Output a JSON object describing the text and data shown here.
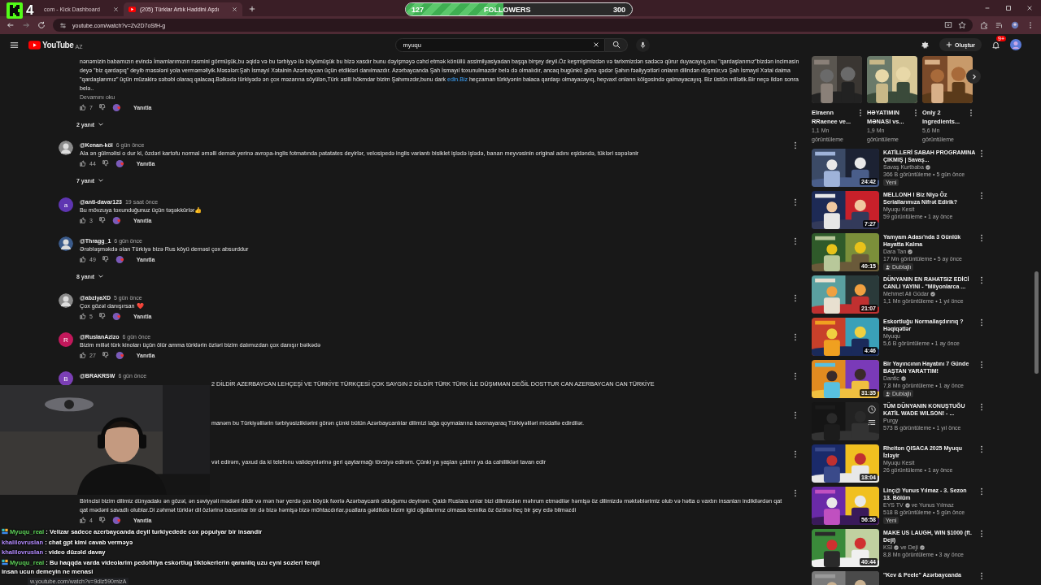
{
  "browser": {
    "tabs": [
      {
        "title": "com - Kick Dashboard",
        "selected": false
      },
      {
        "title": "(205) Türklar Artık Haddini Aşdı",
        "selected": true
      }
    ],
    "url": "youtube.com/watch?v=Zv2D7oSfH-g"
  },
  "overlay": {
    "kick_count": "4",
    "followers": {
      "current": "127",
      "label": "FOLLOWERS",
      "goal": "300",
      "level": 0.43
    }
  },
  "youtube": {
    "logo": "YouTube",
    "region": "AZ",
    "search": "myuqu",
    "create": "Oluştur",
    "notifications": "9+"
  },
  "top_comment": {
    "body_parts": [
      {
        "text": "nənəmizin babamızın evində İmamlarımızın rəsmini görmüşük,bu əqidə və bu tərbiyyə ilə böyümüşük bu bizə xasdır bunu dəyişməyə cəhd etmək könüllü assimilyasiyadan başqa birşey deyil.Öz keşmişimizdən və tarixmizdən sadəcə qürur duyacayıq,onu \"qardaşlarımız\"bizdən incimasin deyə \"biz qardaşıq\" deyib məsələni yola verməməliyik.Məsələn:Şah İsmayıl Xətainin Azərbaycan üçün etdikləri danılmazdır. Azərbaycanda Şah İsmayıl toxunulmazdır belə də olmalıdır, ancaq bugünkü günə qədər Şahın fəaliyyətləri onların dilindən düşmür,və Şah İsmayıl Xətai daima \"qardaşlarımız\" üçün müzakirə səbəbi olaraq qalacaq.Bəlkədə türkiyədə ən çox məzarına söyülən,Türk əsilli hökmdar bizim Şahımızdır,bunu dark ",
        "link": false
      },
      {
        "text": "edin.Biz",
        "link": true
      },
      {
        "text": " heçzaman türkiyənin balaca qardaşı olmayacayıq, heçvaxt onların kölgəsində qalmayacayıq. Biz üstün millətik.Bir neçə ildən sonra belə..",
        "link": false
      }
    ],
    "read_more": "Devamını oku",
    "likes": "7",
    "reply": "Yanıtla",
    "replies": "2 yanıt"
  },
  "comments": [
    {
      "author": "@Kenan-köl",
      "time": "6 gün önce",
      "text": "Ala ən gülməlisi o dur ki, özdəri kartofu normal əməlli demək yerinə avropa-inglis fotmatında patatates deyirlər, velosipedə inglis variantı bisiklet işlədə işlədə, banan meyvəsinin original adını eşidəndə, tükləri səpələnir",
      "covered": false,
      "likes": "44",
      "reply": "Yanıtla",
      "replies": "7 yanıt"
    },
    {
      "author": "@anti-davar123",
      "time": "19 saat önce",
      "avatar": {
        "kind": "letter",
        "letter": "a",
        "color": "#5e35b1"
      },
      "text": "Bu mövzuya toxunduğunuz üçün təşəkkürlər👍",
      "covered": false,
      "likes": "3",
      "reply": "Yanıtla"
    },
    {
      "author": "@Thragg_1",
      "time": "6 gün önce",
      "text": "Ərəbləşməkdə olan Türkiyə bizə Rus köyü deməsi çox absurddur",
      "covered": false,
      "likes": "49",
      "reply": "Yanıtla",
      "replies": "8 yanıt"
    },
    {
      "author": "@abziyaXD",
      "time": "5 gün önce",
      "text": "Çox gözəl danışırsan ❤️",
      "covered": false,
      "likes": "5",
      "reply": "Yanıtla"
    },
    {
      "author": "@RuslanAzizo",
      "time": "6 gün önce",
      "avatar": {
        "kind": "letter",
        "letter": "R",
        "color": "#c2185b"
      },
      "text": "Bizim millət türk kinoları üçün ölür amma türklərin özləri bizim dalımızdan çox danışır bəlkədə",
      "covered": false,
      "likes": "27",
      "reply": "Yanıtla"
    },
    {
      "author": "@BRAKRSW",
      "time": "6 gün önce",
      "avatar": {
        "kind": "letter",
        "letter": "B",
        "color": "#7b3fb5"
      },
      "text": "2 DİLDİR AZERBAYCAN LEHÇEŞİ VE TÜRKİYE TÜRKÇESİ ÇOK SAYGIN 2 DİLDİR TÜRK TÜRK İLE DÜŞMMAN DEĞİL DOSTTUR CAN AZERBAYCAN CAN TÜRKİYE",
      "covered": true
    },
    {
      "text": "manəm bu Türkiyəlilərin tərbiyəsizliklərini görən çünki bütün Azərbaycanlılar dilimizi lağa qoymalarına baxmayaraq Türkiyəliləri müdafiə edirdilər.",
      "covered": true
    },
    {
      "text": "vət edirəm, yaxud da ki telefonu valideynlərinə geri qaytarmağı tövsiyə edirəm. Çünki ya yaşları çatmır ya da cahillikləri tavan edir",
      "covered": true
    },
    {
      "text": "Birincisi bizim dilimiz dünyadakı ən gözəl, ən səviyyəli mədəni dildir və mən hər yerdə çox böyük fəxrlə Azərbaycanlı olduğumu deyirəm. Qaldı Ruslara onlar bizi dilimizdən məhrum etmədilər həmişə öz dilimizdə məktəblərimiz olub və hətta o vaxtın insanları indikilərdən qat qat mədəni savadlı olublar.Di zəhmət türklər dil özlərinə baxsınlar bir də bizə həmişə bizə möhtacdırlar.puallara gəldikdə bizim igid oğullarımız olmasa texnika öz özünə heç bir şey edə bilməzdi",
      "covered": false,
      "likes": "4",
      "reply": "Yanıtla"
    }
  ],
  "sidebar": {
    "shorts": [
      {
        "title": "Elraenn RRaenee ve...",
        "views": "1,1 Mn görüntüleme"
      },
      {
        "title": "HƏYATIMIN MƏNASI vs...",
        "views": "1,9 Mn görüntüleme"
      },
      {
        "title": "Only 2 Ingredients...",
        "views": "5,6 Mn görüntüleme"
      }
    ],
    "videos": [
      {
        "title": "KATİLLERİ SABAH PROGRAMINA ÇIKMIŞ | Savaş...",
        "channels": [
          {
            "name": "Savaş Kurtbaba",
            "verified": true
          }
        ],
        "meta": "366 B görüntüleme • 5 gün önce",
        "badge": {
          "kind": "new",
          "text": "Yeni"
        },
        "duration": "24:42",
        "hovered": false
      },
      {
        "title": "MELLONH I Biz Niyə Öz Seriallarımıza Nifrət Edirik?",
        "channels": [
          {
            "name": "Myuqu Kesit",
            "verified": false
          }
        ],
        "meta": "59 görüntüleme • 1 ay önce",
        "duration": "7:27",
        "hovered": false
      },
      {
        "title": "Yamyam Adası'nda 3 Günlük Hayatta Kalma",
        "channels": [
          {
            "name": "Dara Tan",
            "verified": true
          }
        ],
        "meta": "17 Mn görüntüleme • 5 ay önce",
        "badge": {
          "kind": "dubbed",
          "text": "Dublajlı"
        },
        "duration": "40:15",
        "hovered": false
      },
      {
        "title": "DÜNYANIN EN RAHATSIZ EDİCİ CANLI YAYINI - \"Milyonlarca ...",
        "channels": [
          {
            "name": "Mehmet Ali Güdar",
            "verified": true
          }
        ],
        "meta": "1,1 Mn görüntüleme • 1 yıl önce",
        "duration": "21:07",
        "hovered": false
      },
      {
        "title": "Eskortluğu Normallaşdırırıq ? Həqiqətlər",
        "channels": [
          {
            "name": "Myuqu",
            "verified": false
          }
        ],
        "meta": "5,6 B görüntüleme • 1 ay önce",
        "duration": "4:46",
        "hovered": false
      },
      {
        "title": "Bir Yayıncının Hayatını 7 Günde BAŞTAN YARATTIM!",
        "channels": [
          {
            "name": "Dantic",
            "verified": true
          }
        ],
        "meta": "7,8 Mn görüntüleme • 1 ay önce",
        "badge": {
          "kind": "dubbed",
          "text": "Dublajlı"
        },
        "duration": "31:35",
        "hovered": false
      },
      {
        "title": "TÜM DÜNYANIN KONUŞTUĞU KATİL WADE WILSON! - ...",
        "channels": [
          {
            "name": "Purgy",
            "verified": false
          }
        ],
        "meta": "573 B görüntüleme • 1 yıl önce",
        "hovered": true
      },
      {
        "title": "Rheiton QISACA 2025 Myuqu İzləyir",
        "channels": [
          {
            "name": "Myuqu Kesit",
            "verified": false
          }
        ],
        "meta": "26 görüntüleme • 1 ay önce",
        "duration": "18:04",
        "hovered": false
      },
      {
        "title": "Linç@ Yunus Yılmaz - 3. Sezon 13. Bölüm",
        "channels": [
          {
            "name": "EYS TV",
            "verified": true
          },
          {
            "name": "ve Yunus Yılmaz",
            "verified": false
          }
        ],
        "meta": "518 B görüntüleme • 5 gün önce",
        "badge": {
          "kind": "new",
          "text": "Yeni"
        },
        "duration": "56:58",
        "hovered": false
      },
      {
        "title": "MAKE US LAUGH, WIN $1000 (ft. Deji)",
        "channels": [
          {
            "name": "KSI",
            "verified": true
          },
          {
            "name": "ve Deji",
            "verified": true
          }
        ],
        "meta": "8,8 Mn görüntüleme • 3 ay önce",
        "duration": "40:44",
        "hovered": false
      },
      {
        "title": "\"Kev & Peele\" Azərbaycanda",
        "hovered": false
      }
    ]
  },
  "chat": [
    {
      "user": "Myuqu_real",
      "color": "#5fd35a",
      "badge": true,
      "text": ": Velizar sadece azerbaycanda deyil turkiyedede cox populyar bir insandir"
    },
    {
      "user": "khalilovruslan",
      "color": "#b58cff",
      "badge": false,
      "text": ": chat gpt kimi cavab verməyə"
    },
    {
      "user": "khalilovruslan",
      "color": "#b58cff",
      "badge": false,
      "text": ": video düzəld davay"
    },
    {
      "user": "Myuqu_real",
      "color": "#5fd35a",
      "badge": true,
      "text": ": Bu haqqda varda videolarim pedofiliya eskortlug tiktokerlerin qaranliq uzu eyni sozleri ferqli insan ucun demeyin ne menasi"
    }
  ],
  "status_url": "w.youtube.com/watch?v=9dlz590mizA"
}
